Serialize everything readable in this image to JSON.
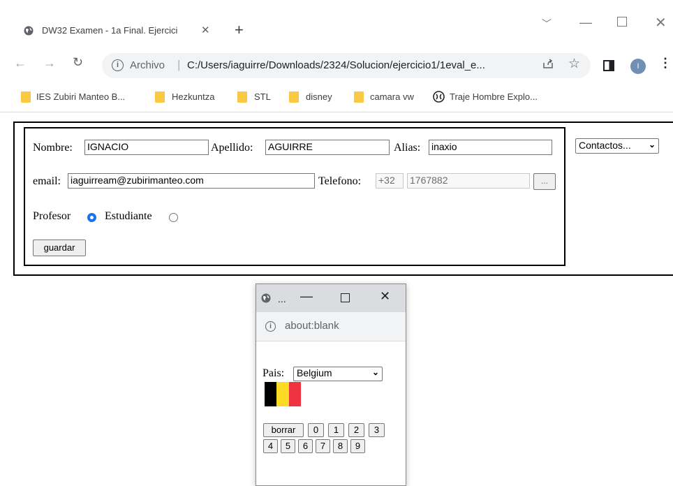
{
  "browser": {
    "tab_title": "DW32 Examen - 1a Final. Ejercici",
    "tab_close": "✕",
    "new_tab": "+",
    "address_scheme": "Archivo",
    "address_separator": "|",
    "address_url": "C:/Users/iaguirre/Downloads/2324/Solucion/ejercicio1/1eval_e...",
    "profile_initial": "I",
    "icons": [
      "globe-icon",
      "back-icon",
      "forward-icon",
      "reload-icon",
      "info-icon",
      "share-icon",
      "star-icon",
      "side-panel-icon",
      "menu-icon"
    ]
  },
  "bookmarks": [
    {
      "label": "IES Zubiri Manteo B...",
      "icon": "folder-icon"
    },
    {
      "label": "Hezkuntza",
      "icon": "folder-icon"
    },
    {
      "label": "STL",
      "icon": "folder-icon"
    },
    {
      "label": "disney",
      "icon": "folder-icon"
    },
    {
      "label": "camara vw",
      "icon": "folder-icon"
    },
    {
      "label": "Traje Hombre Explo...",
      "icon": "site-icon"
    }
  ],
  "form": {
    "nombre_label": "Nombre:",
    "nombre_value": "IGNACIO",
    "apellido_label": "Apellido:",
    "apellido_value": "AGUIRRE",
    "alias_label": "Alias:",
    "alias_value": "inaxio",
    "email_label": "email:",
    "email_value": "iaguirream@zubirimanteo.com",
    "telefono_label": "Telefono:",
    "telefono_prefix": "+32",
    "telefono_value": "1767882",
    "telefono_button": "...",
    "profesor_label": "Profesor",
    "estudiante_label": "Estudiante",
    "profesor_checked": true,
    "estudiante_checked": false,
    "guardar_label": "guardar"
  },
  "contactos_select": {
    "selected": "Contactos..."
  },
  "popup": {
    "title": "...",
    "url": "about:blank",
    "pais_label": "Pais:",
    "pais_selected": "Belgium",
    "flag_colors": [
      "#000000",
      "#fdda24",
      "#ef3340"
    ],
    "keypad_row1": [
      "borrar",
      "0",
      "1",
      "2",
      "3"
    ],
    "keypad_row2": [
      "4",
      "5",
      "6",
      "7",
      "8",
      "9"
    ]
  },
  "colors": {
    "radio_checked": "#1a73e8",
    "folder": "#f9c844",
    "avatar": "#6f8fb5"
  }
}
